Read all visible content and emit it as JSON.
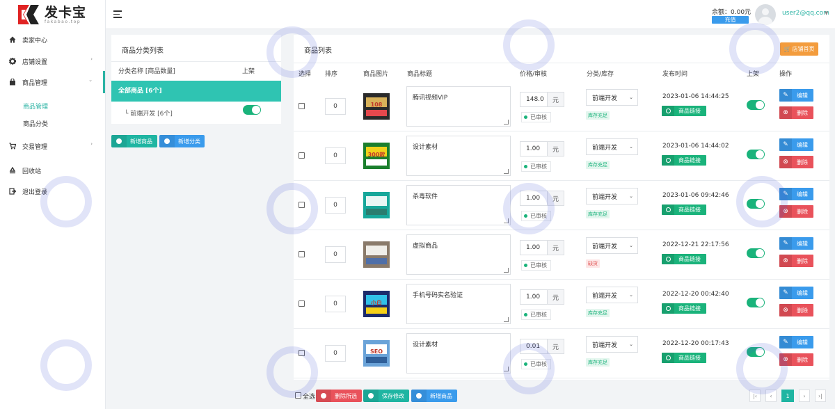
{
  "brand": {
    "name": "发卡宝",
    "sub": "fakabao.top"
  },
  "sidebar": {
    "items": [
      {
        "label": "卖家中心",
        "icon": "home-icon"
      },
      {
        "label": "店铺设置",
        "icon": "gear-icon"
      },
      {
        "label": "商品管理",
        "icon": "bag-icon"
      },
      {
        "label": "交易管理",
        "icon": "cart-icon"
      },
      {
        "label": "回收站",
        "icon": "recycle-icon"
      },
      {
        "label": "退出登录",
        "icon": "logout-icon"
      }
    ],
    "sub_items": [
      "商品管理",
      "商品分类"
    ]
  },
  "header": {
    "balance": "余额：0.00元",
    "recharge": "充值",
    "user": "user2@qq.com"
  },
  "category_panel": {
    "title": "商品分类列表",
    "col_name": "分类名称 [商品数量]",
    "col_onshelf": "上架",
    "all_label": "全部商品 [6个]",
    "sub_label": "└ 前端开发 [6个]",
    "add_product": "新增商品",
    "add_category": "新增分类"
  },
  "product_panel": {
    "title": "商品列表",
    "shop_home": "店铺首页",
    "columns": [
      "选择",
      "排序",
      "商品图片",
      "商品标题",
      "价格/审核",
      "分类/库存",
      "发布时间",
      "上架",
      "操作"
    ],
    "rows": [
      {
        "sort": "0",
        "title": "腾讯视频VIP",
        "price": "148.0",
        "unit": "元",
        "audit": "已审核",
        "category": "前端开发",
        "stock": "库存充足",
        "stock_ok": true,
        "time": "2023-01-06 14:44:25"
      },
      {
        "sort": "0",
        "title": "设计素材",
        "price": "1.00",
        "unit": "元",
        "audit": "已审核",
        "category": "前端开发",
        "stock": "库存充足",
        "stock_ok": true,
        "time": "2023-01-06 14:44:02"
      },
      {
        "sort": "0",
        "title": "杀毒软件",
        "price": "1.00",
        "unit": "元",
        "audit": "已审核",
        "category": "前端开发",
        "stock": "库存充足",
        "stock_ok": true,
        "time": "2023-01-06 09:42:46"
      },
      {
        "sort": "0",
        "title": "虚拟商品",
        "price": "1.00",
        "unit": "元",
        "audit": "已审核",
        "category": "前端开发",
        "stock": "缺货",
        "stock_ok": false,
        "time": "2022-12-21 22:17:56"
      },
      {
        "sort": "0",
        "title": "手机号码实名验证",
        "price": "1.00",
        "unit": "元",
        "audit": "已审核",
        "category": "前端开发",
        "stock": "库存充足",
        "stock_ok": true,
        "time": "2022-12-20 00:42:40"
      },
      {
        "sort": "0",
        "title": "设计素材",
        "price": "0.01",
        "unit": "元",
        "audit": "已审核",
        "category": "前端开发",
        "stock": "库存充足",
        "stock_ok": true,
        "time": "2022-12-20 00:17:43"
      }
    ],
    "link_label": "商品链接",
    "edit_label": "编辑",
    "delete_label": "删除",
    "select_all": "全选",
    "delete_selected": "删除所选",
    "save_changes": "保存修改",
    "add_product": "新增商品",
    "current_page": "1"
  },
  "thumbs": [
    {
      "text": "108"
    },
    {
      "text": "300款"
    },
    {
      "text": ""
    },
    {
      "text": ""
    },
    {
      "text": "小白"
    },
    {
      "text": "SEO"
    }
  ],
  "colors": {
    "accent": "#2bb3a4",
    "blue": "#3a9bec",
    "green": "#1ab37b",
    "red": "#e9525b",
    "orange": "#f39c3d"
  }
}
